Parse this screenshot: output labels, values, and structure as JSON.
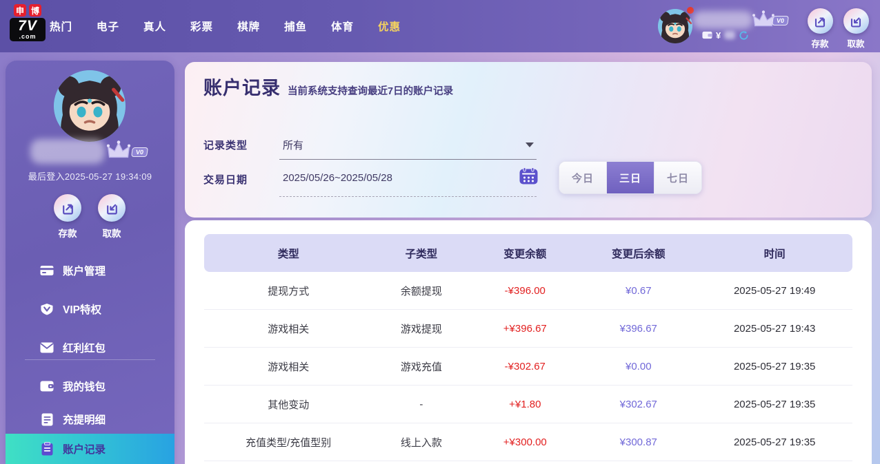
{
  "colors": {
    "navbar_purple": "#6a5bb0",
    "sidebar_purple": "#6e61b6",
    "active_item_gradient_start": "#3fe0c4",
    "active_item_gradient_end": "#28a2e2",
    "selected_toggle_purple": "#7a6cc6",
    "change_amount_red": "#e22020",
    "balance_amount_purple": "#7168d8",
    "table_header_lavender": "#dbdbf6",
    "highlight_yellow": "#f5d35e",
    "logo_badge_red": "#e5202e"
  },
  "icons": {
    "crown-icon": "crown shape (SVG)",
    "wallet-icon": "wallet glyph (SVG)",
    "refresh-icon": "circular arrow (SVG)",
    "deposit-icon": "arrow into box (SVG)",
    "withdraw-icon": "arrow out of box (SVG)",
    "bank-card-icon": "credit card (SVG)",
    "vip-shield-icon": "shield with chevron (SVG)",
    "red-packet-icon": "envelope (SVG)",
    "statement-icon": "document lines (SVG)",
    "clipboard-icon": "clipboard (SVG)",
    "calendar-icon": "calendar grid (SVG)",
    "chevron-down-icon": "▼",
    "notification-dot": "red dot"
  },
  "navbar": {
    "logo": {
      "badge_left": "申",
      "badge_right": "博",
      "main": "7V",
      "suffix": ".com"
    },
    "items": [
      {
        "label": "热门"
      },
      {
        "label": "电子"
      },
      {
        "label": "真人"
      },
      {
        "label": "彩票"
      },
      {
        "label": "棋牌"
      },
      {
        "label": "捕鱼"
      },
      {
        "label": "体育"
      },
      {
        "label": "优惠",
        "highlighted": true
      }
    ],
    "user": {
      "vip_badge": "V0",
      "currency_symbol": "¥"
    },
    "actions": [
      {
        "label": "存款"
      },
      {
        "label": "取款"
      }
    ]
  },
  "sidebar": {
    "vip_badge": "V0",
    "last_login": "最后登入2025-05-27 19:34:09",
    "actions": [
      {
        "label": "存款"
      },
      {
        "label": "取款"
      }
    ],
    "menu_primary": [
      {
        "label": "账户管理"
      },
      {
        "label": "VIP特权"
      },
      {
        "label": "红利红包"
      }
    ],
    "menu_secondary": [
      {
        "label": "我的钱包"
      },
      {
        "label": "充提明细"
      },
      {
        "label": "账户记录",
        "active": true
      }
    ]
  },
  "main": {
    "title": "账户记录",
    "subtitle": "当前系统支持查询最近7日的账户记录",
    "filters": {
      "record_type_label": "记录类型",
      "record_type_value": "所有",
      "date_label": "交易日期",
      "date_value": "2025/05/26~2025/05/28",
      "quick_ranges": [
        {
          "label": "今日",
          "active": false
        },
        {
          "label": "三日",
          "active": true
        },
        {
          "label": "七日",
          "active": false
        }
      ]
    },
    "table": {
      "columns": [
        "类型",
        "子类型",
        "变更余额",
        "变更后余额",
        "时间"
      ],
      "rows": [
        {
          "type": "提现方式",
          "subtype": "余额提现",
          "change": "-¥396.00",
          "balance": "¥0.67",
          "time": "2025-05-27 19:49"
        },
        {
          "type": "游戏相关",
          "subtype": "游戏提现",
          "change": "+¥396.67",
          "balance": "¥396.67",
          "time": "2025-05-27 19:43"
        },
        {
          "type": "游戏相关",
          "subtype": "游戏充值",
          "change": "-¥302.67",
          "balance": "¥0.00",
          "time": "2025-05-27 19:35"
        },
        {
          "type": "其他变动",
          "subtype": "-",
          "change": "+¥1.80",
          "balance": "¥302.67",
          "time": "2025-05-27 19:35"
        },
        {
          "type": "充值类型/充值型别",
          "subtype": "线上入款",
          "change": "+¥300.00",
          "balance": "¥300.87",
          "time": "2025-05-27 19:35"
        }
      ]
    }
  }
}
